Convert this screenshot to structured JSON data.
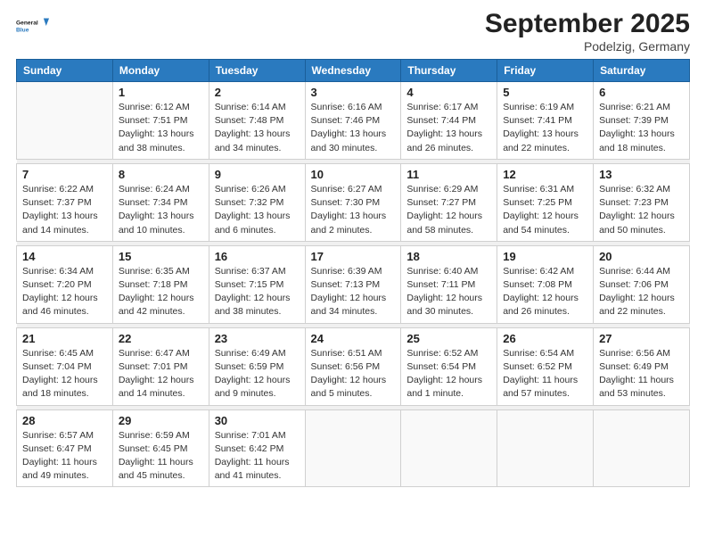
{
  "header": {
    "logo_line1": "General",
    "logo_line2": "Blue",
    "month_title": "September 2025",
    "location": "Podelzig, Germany"
  },
  "weekdays": [
    "Sunday",
    "Monday",
    "Tuesday",
    "Wednesday",
    "Thursday",
    "Friday",
    "Saturday"
  ],
  "weeks": [
    [
      {
        "day": "",
        "info": ""
      },
      {
        "day": "1",
        "info": "Sunrise: 6:12 AM\nSunset: 7:51 PM\nDaylight: 13 hours\nand 38 minutes."
      },
      {
        "day": "2",
        "info": "Sunrise: 6:14 AM\nSunset: 7:48 PM\nDaylight: 13 hours\nand 34 minutes."
      },
      {
        "day": "3",
        "info": "Sunrise: 6:16 AM\nSunset: 7:46 PM\nDaylight: 13 hours\nand 30 minutes."
      },
      {
        "day": "4",
        "info": "Sunrise: 6:17 AM\nSunset: 7:44 PM\nDaylight: 13 hours\nand 26 minutes."
      },
      {
        "day": "5",
        "info": "Sunrise: 6:19 AM\nSunset: 7:41 PM\nDaylight: 13 hours\nand 22 minutes."
      },
      {
        "day": "6",
        "info": "Sunrise: 6:21 AM\nSunset: 7:39 PM\nDaylight: 13 hours\nand 18 minutes."
      }
    ],
    [
      {
        "day": "7",
        "info": "Sunrise: 6:22 AM\nSunset: 7:37 PM\nDaylight: 13 hours\nand 14 minutes."
      },
      {
        "day": "8",
        "info": "Sunrise: 6:24 AM\nSunset: 7:34 PM\nDaylight: 13 hours\nand 10 minutes."
      },
      {
        "day": "9",
        "info": "Sunrise: 6:26 AM\nSunset: 7:32 PM\nDaylight: 13 hours\nand 6 minutes."
      },
      {
        "day": "10",
        "info": "Sunrise: 6:27 AM\nSunset: 7:30 PM\nDaylight: 13 hours\nand 2 minutes."
      },
      {
        "day": "11",
        "info": "Sunrise: 6:29 AM\nSunset: 7:27 PM\nDaylight: 12 hours\nand 58 minutes."
      },
      {
        "day": "12",
        "info": "Sunrise: 6:31 AM\nSunset: 7:25 PM\nDaylight: 12 hours\nand 54 minutes."
      },
      {
        "day": "13",
        "info": "Sunrise: 6:32 AM\nSunset: 7:23 PM\nDaylight: 12 hours\nand 50 minutes."
      }
    ],
    [
      {
        "day": "14",
        "info": "Sunrise: 6:34 AM\nSunset: 7:20 PM\nDaylight: 12 hours\nand 46 minutes."
      },
      {
        "day": "15",
        "info": "Sunrise: 6:35 AM\nSunset: 7:18 PM\nDaylight: 12 hours\nand 42 minutes."
      },
      {
        "day": "16",
        "info": "Sunrise: 6:37 AM\nSunset: 7:15 PM\nDaylight: 12 hours\nand 38 minutes."
      },
      {
        "day": "17",
        "info": "Sunrise: 6:39 AM\nSunset: 7:13 PM\nDaylight: 12 hours\nand 34 minutes."
      },
      {
        "day": "18",
        "info": "Sunrise: 6:40 AM\nSunset: 7:11 PM\nDaylight: 12 hours\nand 30 minutes."
      },
      {
        "day": "19",
        "info": "Sunrise: 6:42 AM\nSunset: 7:08 PM\nDaylight: 12 hours\nand 26 minutes."
      },
      {
        "day": "20",
        "info": "Sunrise: 6:44 AM\nSunset: 7:06 PM\nDaylight: 12 hours\nand 22 minutes."
      }
    ],
    [
      {
        "day": "21",
        "info": "Sunrise: 6:45 AM\nSunset: 7:04 PM\nDaylight: 12 hours\nand 18 minutes."
      },
      {
        "day": "22",
        "info": "Sunrise: 6:47 AM\nSunset: 7:01 PM\nDaylight: 12 hours\nand 14 minutes."
      },
      {
        "day": "23",
        "info": "Sunrise: 6:49 AM\nSunset: 6:59 PM\nDaylight: 12 hours\nand 9 minutes."
      },
      {
        "day": "24",
        "info": "Sunrise: 6:51 AM\nSunset: 6:56 PM\nDaylight: 12 hours\nand 5 minutes."
      },
      {
        "day": "25",
        "info": "Sunrise: 6:52 AM\nSunset: 6:54 PM\nDaylight: 12 hours\nand 1 minute."
      },
      {
        "day": "26",
        "info": "Sunrise: 6:54 AM\nSunset: 6:52 PM\nDaylight: 11 hours\nand 57 minutes."
      },
      {
        "day": "27",
        "info": "Sunrise: 6:56 AM\nSunset: 6:49 PM\nDaylight: 11 hours\nand 53 minutes."
      }
    ],
    [
      {
        "day": "28",
        "info": "Sunrise: 6:57 AM\nSunset: 6:47 PM\nDaylight: 11 hours\nand 49 minutes."
      },
      {
        "day": "29",
        "info": "Sunrise: 6:59 AM\nSunset: 6:45 PM\nDaylight: 11 hours\nand 45 minutes."
      },
      {
        "day": "30",
        "info": "Sunrise: 7:01 AM\nSunset: 6:42 PM\nDaylight: 11 hours\nand 41 minutes."
      },
      {
        "day": "",
        "info": ""
      },
      {
        "day": "",
        "info": ""
      },
      {
        "day": "",
        "info": ""
      },
      {
        "day": "",
        "info": ""
      }
    ]
  ]
}
